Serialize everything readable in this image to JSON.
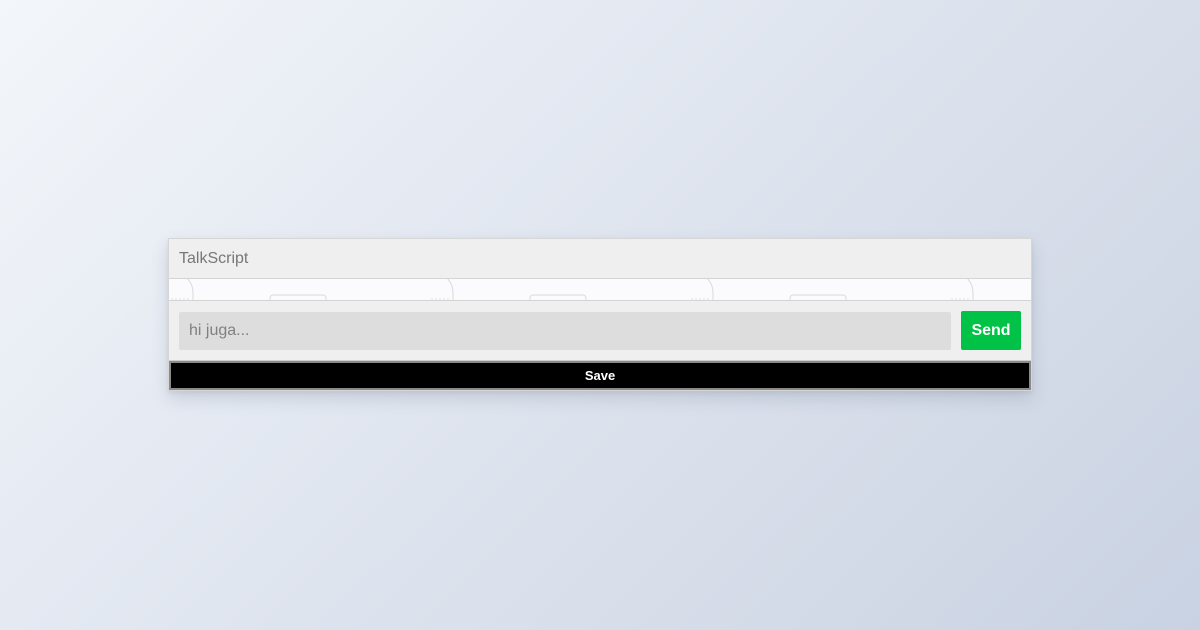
{
  "app": {
    "title": "TalkScript"
  },
  "composer": {
    "placeholder": "hi juga...",
    "send_label": "Send"
  },
  "actions": {
    "save_label": "Save"
  },
  "colors": {
    "send": "#00c247",
    "save": "#000000",
    "header": "#efefef",
    "input": "#dddddd"
  },
  "icons": {
    "chat_pattern": "chat-background-pattern"
  }
}
